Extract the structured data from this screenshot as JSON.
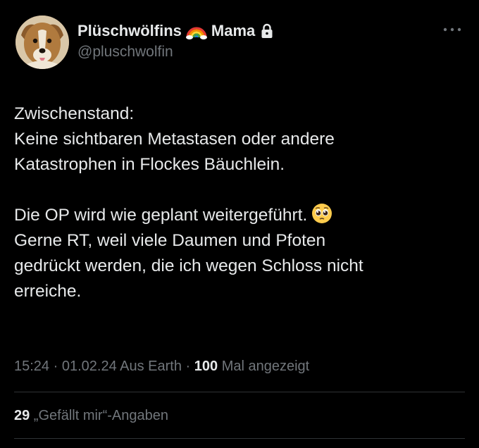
{
  "author": {
    "display_name": "Plüschwölfins",
    "name_suffix": "Mama",
    "handle": "@pluschwolfin",
    "avatar_icon": "dog-avatar",
    "rainbow_icon": "rainbow-emoji",
    "lock_icon": "lock-icon",
    "more_icon": "more-options-icon"
  },
  "tweet": {
    "paragraph1_line1": "Zwischenstand:",
    "paragraph1_line2": "Keine sichtbaren Metastasen oder andere",
    "paragraph1_line3": "Katastrophen in Flockes Bäuchlein.",
    "paragraph2_line1": "Die OP wird wie geplant weitergeführt.",
    "paragraph2_emoji": "pleading-face-emoji",
    "paragraph2_line2": "Gerne RT, weil viele Daumen und Pfoten",
    "paragraph2_line3": "gedrückt werden, die ich wegen Schloss nicht",
    "paragraph2_line4": "erreiche."
  },
  "meta": {
    "time": "15:24",
    "sep1": " · ",
    "date": "01.02.24",
    "location": " Aus Earth",
    "sep2": " · ",
    "views_count": "100",
    "views_label": " Mal angezeigt"
  },
  "stats": {
    "likes_count": "29",
    "likes_label": " „Gefällt mir“-Angaben"
  },
  "colors": {
    "background": "#000000",
    "text_primary": "#e7e9ea",
    "text_secondary": "#71767b",
    "divider": "#2f3336"
  }
}
